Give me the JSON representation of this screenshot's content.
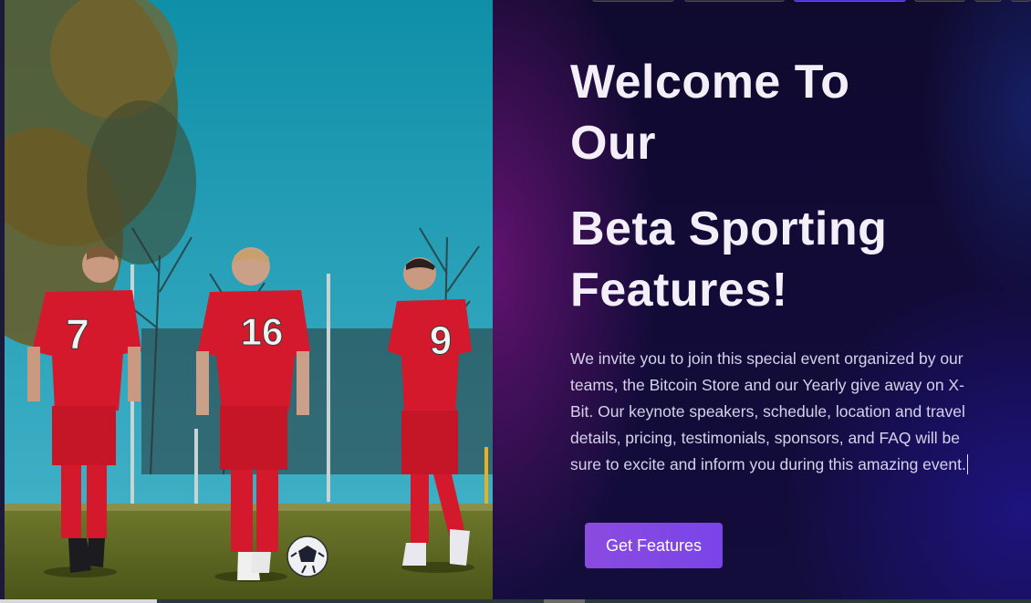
{
  "hero": {
    "title_line1": "Welcome To",
    "title_line2": "Our",
    "title_line3": "Beta Sporting",
    "title_line4": "Features!",
    "description": "We invite you to join this special event organized by our teams, the Bitcoin Store and our Yearly give away on X-Bit. Our keynote speakers, schedule, location and travel details, pricing, testimonials, sponsors, and FAQ will be sure to excite and inform you during this amazing event.",
    "cta_label": "Get Features"
  },
  "players": [
    {
      "number": "7"
    },
    {
      "number": "16"
    },
    {
      "number": "9"
    }
  ],
  "colors": {
    "background": "#120b38",
    "accent": "#8a4be0",
    "text": "#f3eef7",
    "jersey": "#d4192c"
  }
}
